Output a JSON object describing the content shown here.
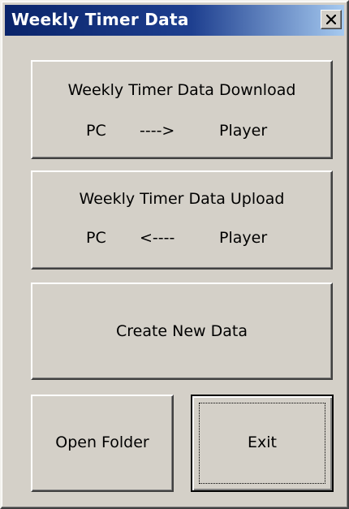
{
  "window": {
    "title": "Weekly Timer Data",
    "close_label": "Close"
  },
  "buttons": {
    "download": {
      "line1": "Weekly Timer Data Download",
      "pc": "PC",
      "arrow": "---->",
      "player": "Player"
    },
    "upload": {
      "line1": "Weekly Timer Data Upload",
      "pc": "PC",
      "arrow": "<----",
      "player": "Player"
    },
    "create": {
      "label": "Create New Data"
    },
    "open_folder": {
      "label": "Open Folder"
    },
    "exit": {
      "label": "Exit"
    }
  },
  "colors": {
    "face": "#d4d0c8",
    "titlebar_start": "#0a246a",
    "titlebar_end": "#a6caf0"
  },
  "icons": {
    "close": "close-icon"
  }
}
